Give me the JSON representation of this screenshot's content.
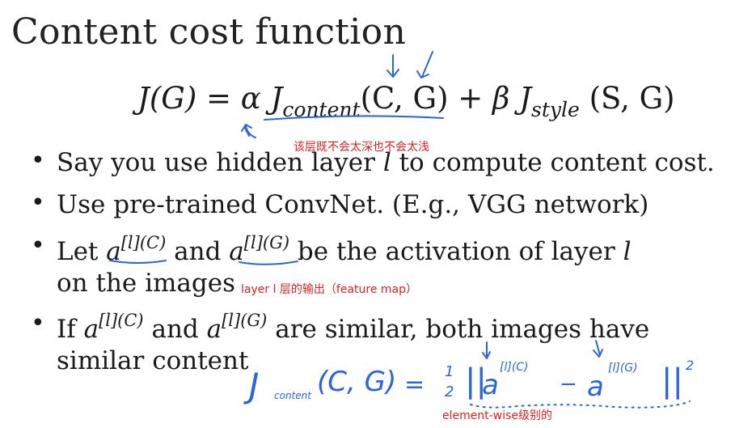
{
  "title": "Content cost function",
  "formula": {
    "lhs": "J(G) = ",
    "alpha": "α",
    "j1": "J",
    "sub1": "content",
    "args1": "(C, G)",
    "plus": " + ",
    "beta": "β",
    "j2": "J",
    "sub2": "style",
    "args2": "(S, G)"
  },
  "notes": {
    "layer_depth": "该层既不会太深也不会太浅",
    "layer_output": "layer l 层的输出（feature map）",
    "elementwise": "element-wise级别的"
  },
  "bullets": {
    "b1": {
      "pre": "Say you use hidden layer ",
      "var": "l",
      "post": " to compute content cost."
    },
    "b2": {
      "text": "Use pre-trained ConvNet. (E.g., VGG network)"
    },
    "b3": {
      "pre": "Let ",
      "a1": "a",
      "sup1": "[l](C)",
      "mid": " and ",
      "a2": "a",
      "sup2": "[l](G)",
      "post": " be the activation of layer ",
      "var": "l",
      "line2": "on the images"
    },
    "b4": {
      "pre": "If ",
      "a1": "a",
      "sup1": "[l](C)",
      "mid": " and ",
      "a2": "a",
      "sup2": "[l](G)",
      "post": " are similar, both images have",
      "line2": "similar content"
    }
  },
  "handwritten": {
    "j": "J",
    "sub": "content",
    "args": "(C, G)",
    "eq": "=",
    "half_num": "1",
    "half_den": "2",
    "bars_open": "||",
    "a1": "a",
    "sup1": "[l](C)",
    "minus": "−",
    "a2": "a",
    "sup2": "[l](G)",
    "bars_close": "||",
    "sq": "2"
  },
  "colors": {
    "note_red": "#e02020",
    "ink_blue": "#2a66d8",
    "text": "#1a1a1a"
  }
}
